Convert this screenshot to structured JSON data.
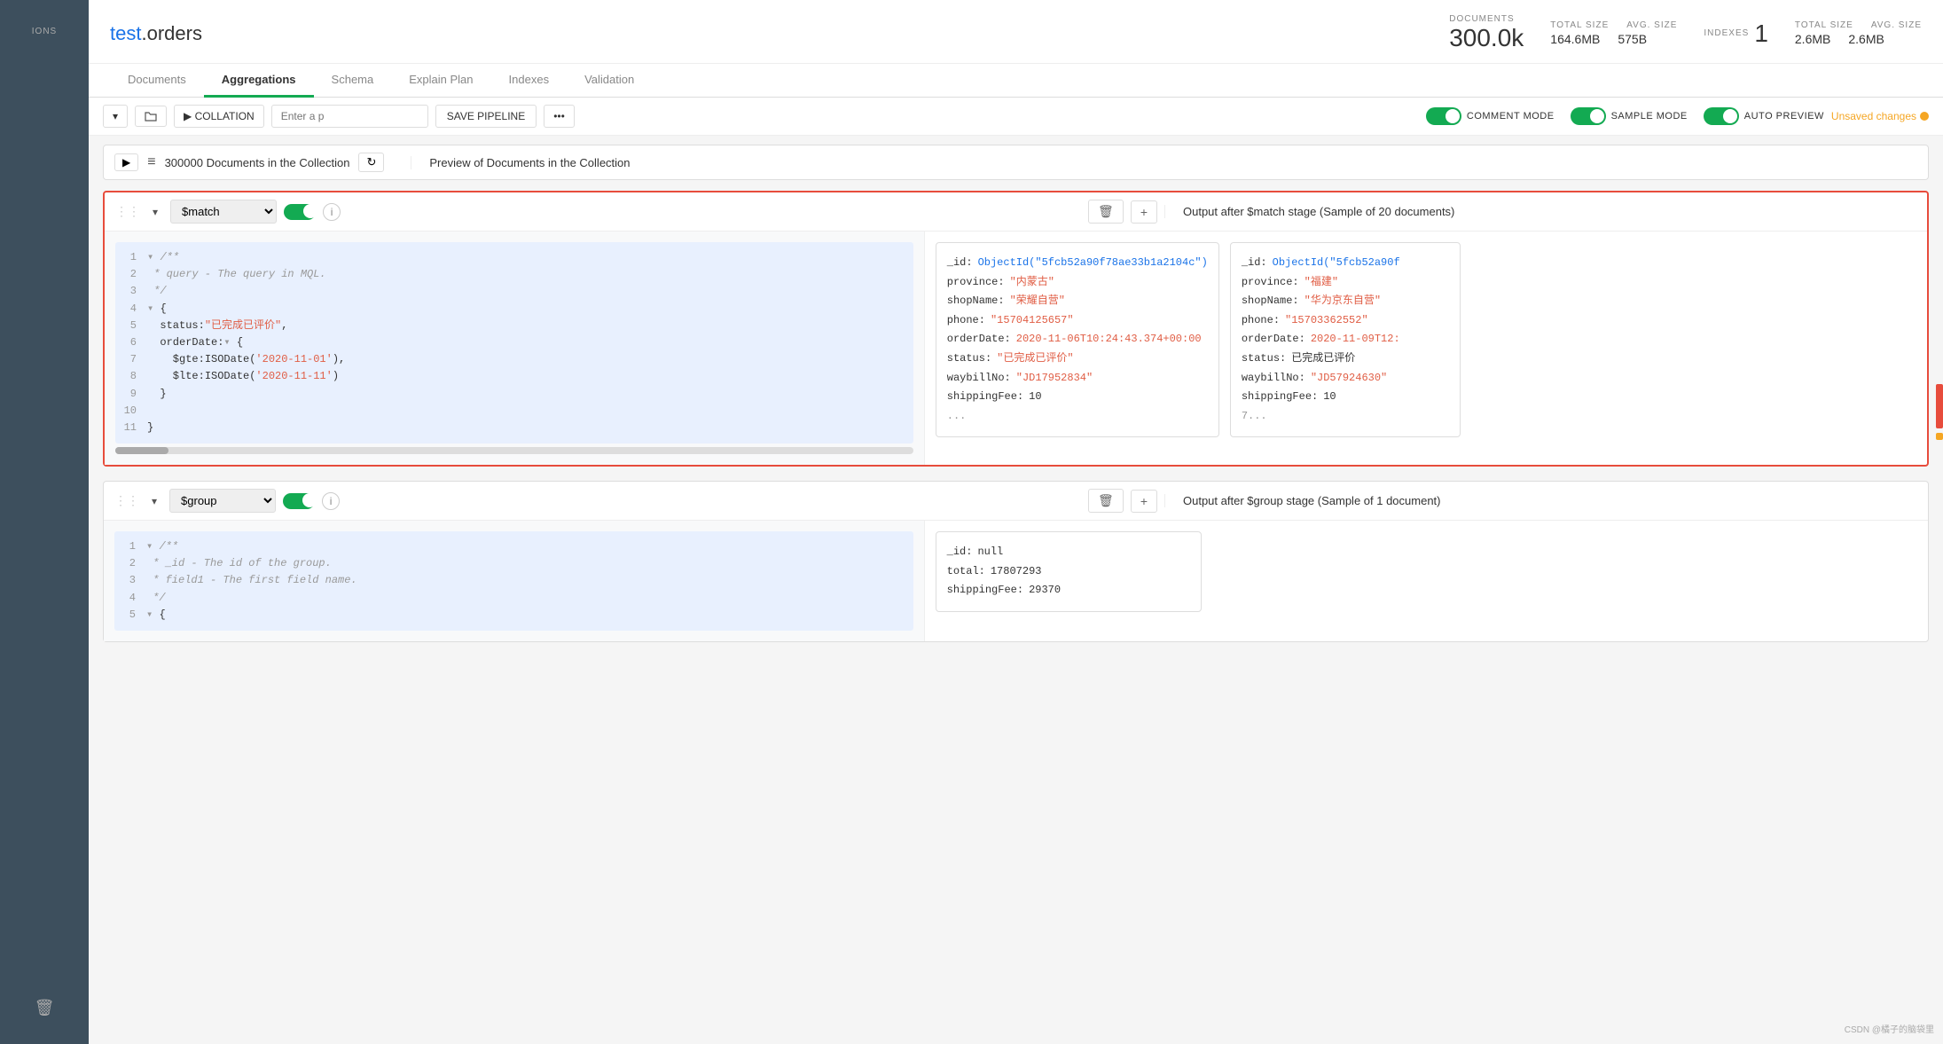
{
  "sidebar": {
    "label": "IONS"
  },
  "header": {
    "title_part1": "test",
    "title_dot": ".",
    "title_part2": "orders",
    "documents_label": "DOCUMENTS",
    "documents_value": "300.0k",
    "total_size_label": "TOTAL SIZE",
    "total_size_value": "164.6MB",
    "avg_size_label": "AVG. SIZE",
    "avg_size_value": "575B",
    "indexes_label": "INDEXES",
    "indexes_value": "1",
    "indexes_total_size_label": "TOTAL SIZE",
    "indexes_total_size_value": "2.6MB",
    "indexes_avg_size_label": "AVG. SIZE",
    "indexes_avg_size_value": "2.6MB"
  },
  "tabs": [
    {
      "label": "Documents",
      "active": false
    },
    {
      "label": "Aggregations",
      "active": true
    },
    {
      "label": "Schema",
      "active": false
    },
    {
      "label": "Explain Plan",
      "active": false
    },
    {
      "label": "Indexes",
      "active": false
    },
    {
      "label": "Validation",
      "active": false
    }
  ],
  "toolbar": {
    "dropdown_btn": "▾",
    "folder_btn": "📁",
    "collation_btn": "▶ COLLATION",
    "pipeline_placeholder": "Enter a p",
    "save_pipeline_label": "SAVE PIPELINE",
    "more_btn": "•••",
    "comment_mode_label": "COMMENT MODE",
    "sample_mode_label": "SAMPLE MODE",
    "auto_preview_label": "AUTO PREVIEW",
    "unsaved_label": "Unsaved changes"
  },
  "collection_stage": {
    "expand_btn": "▶",
    "icon": "≡",
    "label": "300000 Documents in the Collection",
    "output_label": "Preview of Documents in the Collection"
  },
  "match_stage": {
    "collapse_label": "▾",
    "select_value": "$match",
    "info_btn": "i",
    "delete_btn": "🗑",
    "add_btn": "+",
    "output_label": "Output after $match stage (Sample of 20 documents)",
    "code_lines": [
      {
        "num": "1",
        "content": "/**",
        "class": "code-comment",
        "fold": "▾"
      },
      {
        "num": "2",
        "content": " * query - The query in MQL.",
        "class": "code-comment"
      },
      {
        "num": "3",
        "content": " */",
        "class": "code-comment"
      },
      {
        "num": "4",
        "content": "{",
        "fold": "▾"
      },
      {
        "num": "5",
        "content": "  status:\"已完成已评价\","
      },
      {
        "num": "6",
        "content": "  orderDate:{",
        "fold": "▾"
      },
      {
        "num": "7",
        "content": "    $gte:ISODate('2020-11-01'),"
      },
      {
        "num": "8",
        "content": "    $lte:ISODate('2020-11-11')"
      },
      {
        "num": "9",
        "content": "  }"
      },
      {
        "num": "10",
        "content": ""
      },
      {
        "num": "11",
        "content": "}"
      }
    ],
    "doc1": {
      "_id": "ObjectId(\"5fcb52a90f78ae33b1a2104c\")",
      "province": "\"内蒙古\"",
      "shopName": "\"荣耀自营\"",
      "phone": "\"15704125657\"",
      "orderDate": "2020-11-06T10:24:43.374+00:00",
      "status": "\"已完成已评价\"",
      "waybillNo": "\"JD17952834\"",
      "shippingFee": "10",
      "total": "..."
    },
    "doc2": {
      "_id": "ObjectId(\"5fcb52a90f",
      "province": "\"福建\"",
      "shopName": "\"华为京东自营\"",
      "phone": "\"15703362552\"",
      "orderDate": "2020-11-09T12:...",
      "status": "\"已完成已评价\"",
      "waybillNo": "\"JD57924630\"",
      "shippingFee": "10",
      "total": "7..."
    }
  },
  "group_stage": {
    "collapse_label": "▾",
    "select_value": "$group",
    "info_btn": "i",
    "delete_btn": "🗑",
    "add_btn": "+",
    "output_label": "Output after $group stage (Sample of 1 document)",
    "code_lines": [
      {
        "num": "1",
        "content": "/**",
        "class": "code-comment",
        "fold": "▾"
      },
      {
        "num": "2",
        "content": " * _id - The id of the group.",
        "class": "code-comment"
      },
      {
        "num": "3",
        "content": " * field1 - The first field name.",
        "class": "code-comment"
      },
      {
        "num": "4",
        "content": " */",
        "class": "code-comment"
      },
      {
        "num": "5",
        "content": "{",
        "fold": "▾"
      }
    ],
    "doc1": {
      "_id": "null",
      "total": "17807293",
      "shippingFee": "29370"
    }
  },
  "colors": {
    "green": "#13aa52",
    "orange": "#f5a623",
    "red": "#e74c3c",
    "blue": "#1a73e8",
    "value_red": "#e05d44",
    "sidebar_bg": "#3d4f5d"
  }
}
